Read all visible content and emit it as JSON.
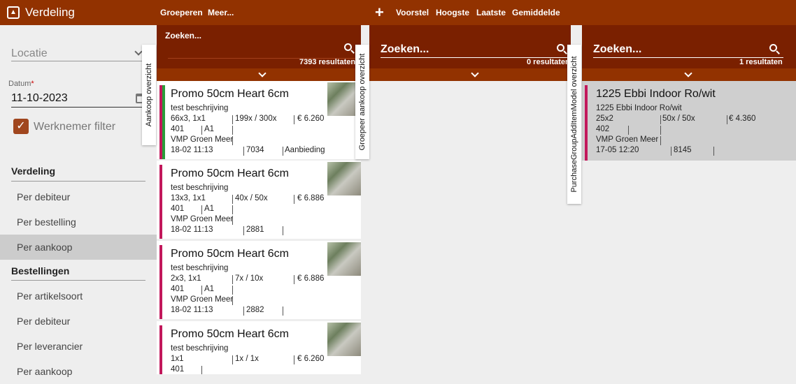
{
  "app": {
    "title": "Verdeling"
  },
  "toolbar": {
    "group_label": "Groeperen",
    "more_label": "Meer...",
    "add_label": "+",
    "proposal_label": "Voorstel",
    "highest_label": "Hoogste",
    "last_label": "Laatste",
    "average_label": "Gemiddelde"
  },
  "filters": {
    "location_placeholder": "Locatie",
    "date_label": "Datum",
    "date_required": "*",
    "date_value": "11-10-2023",
    "employee_filter_label": "Werknemer filter",
    "employee_filter_checked": true
  },
  "nav": {
    "section1": "Verdeling",
    "section1_items": [
      "Per debiteur",
      "Per bestelling",
      "Per aankoop"
    ],
    "active_item": "Per aankoop",
    "section2": "Bestellingen",
    "section2_items": [
      "Per artikelsoort",
      "Per debiteur",
      "Per leverancier",
      "Per aankoop"
    ]
  },
  "column1": {
    "tab_label": "Aankoop overzicht",
    "search_placeholder": "Zoeken...",
    "results": "7393 resultaten",
    "cards": [
      {
        "title": "Promo 50cm Heart 6cm",
        "description": "test beschrijving",
        "qty": "66x3, 1x1",
        "price_ratio": "199x / 300x",
        "price": "€ 6.260",
        "code": "401",
        "grade": "A1",
        "supplier": "VMP Groen Meer",
        "date": "18-02 11:13",
        "number": "7034",
        "tag": "Aanbieding",
        "bar_color": "#c2185b",
        "accent_color": "#2a9d3a"
      },
      {
        "title": "Promo 50cm Heart 6cm",
        "description": "test beschrijving",
        "qty": "13x3, 1x1",
        "price_ratio": "40x / 50x",
        "price": "€ 6.886",
        "code": "401",
        "grade": "A1",
        "supplier": "VMP Groen Meer",
        "date": "18-02 11:13",
        "number": "2881",
        "tag": "",
        "bar_color": "#c2185b"
      },
      {
        "title": "Promo 50cm Heart 6cm",
        "description": "test beschrijving",
        "qty": "2x3, 1x1",
        "price_ratio": "7x / 10x",
        "price": "€ 6.886",
        "code": "401",
        "grade": "A1",
        "supplier": "VMP Groen Meer",
        "date": "18-02 11:13",
        "number": "2882",
        "tag": "",
        "bar_color": "#c2185b"
      },
      {
        "title": "Promo 50cm Heart 6cm",
        "description": "test beschrijving",
        "qty": "1x1",
        "price_ratio": "1x / 1x",
        "price": "€ 6.260",
        "code": "401",
        "grade": "",
        "bar_color": "#c2185b"
      }
    ]
  },
  "column2": {
    "tab_label": "Groepeer aankoop overzicht",
    "search_placeholder": "Zoeken...",
    "results": "0 resultaten"
  },
  "column3": {
    "tab_label": "PurchaseGroupAddItemModel overzicht",
    "search_placeholder": "Zoeken...",
    "results": "1 resultaten",
    "card": {
      "title": "1225 Ebbi Indoor Ro/wit",
      "description": "1225 Ebbi Indoor Ro/wit",
      "qty": "25x2",
      "price_ratio": "50x / 50x",
      "price": "€ 4.360",
      "code": "402",
      "supplier": "VMP Groen Meer",
      "date": "17-05 12:20",
      "number": "8145",
      "bar_color": "#c2185b"
    }
  }
}
